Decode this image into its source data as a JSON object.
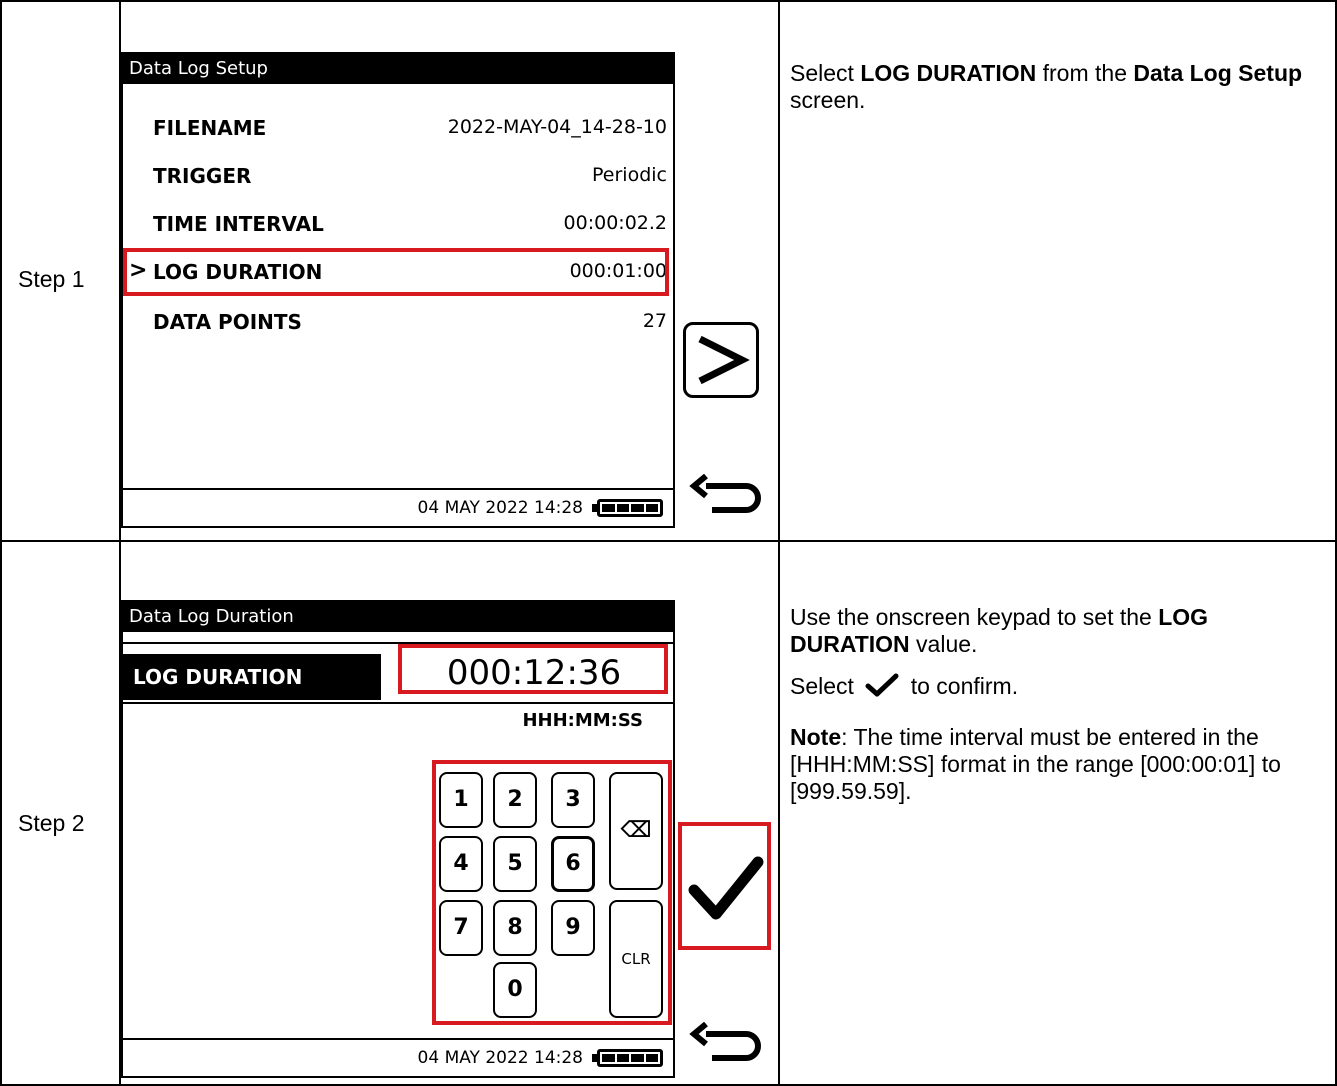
{
  "steps": [
    {
      "label": "Step 1",
      "screen": {
        "title": "Data Log Setup",
        "rows": [
          {
            "label": "FILENAME",
            "value": "2022-MAY-04_14-28-10"
          },
          {
            "label": "TRIGGER",
            "value": "Periodic"
          },
          {
            "label": "TIME INTERVAL",
            "value": "00:00:02.2"
          },
          {
            "label": "LOG DURATION",
            "value": "000:01:00",
            "selected": true
          },
          {
            "label": "DATA POINTS",
            "value": "27"
          }
        ],
        "selector_glyph": ">",
        "status": "04 MAY 2022 14:28"
      },
      "description": {
        "p1_a": "Select ",
        "p1_b": "LOG DURATION",
        "p1_c": " from the ",
        "p1_d": "Data Log Setup",
        "p1_e": " screen."
      }
    },
    {
      "label": "Step 2",
      "screen": {
        "title": "Data Log Duration",
        "field_label": "LOG DURATION",
        "field_value": "000:12:36",
        "format": "HHH:MM:SS",
        "keys": [
          "1",
          "2",
          "3",
          "4",
          "5",
          "6",
          "7",
          "8",
          "9",
          "0"
        ],
        "clear_key": "CLR",
        "backspace_glyph": "⌫",
        "status": "04 MAY 2022 14:28"
      },
      "description": {
        "p1_a": "Use the onscreen keypad to set the ",
        "p1_b": "LOG DURATION",
        "p1_c": " value.",
        "p2_a": "Select ",
        "p2_b": " to confirm.",
        "p3_a": "Note",
        "p3_b": ": The time interval must be entered in the [HHH:MM:SS] format in the range [000:00:01] to [999.59.59]."
      }
    }
  ],
  "colors": {
    "highlight": "#d71920",
    "ink": "#000000"
  },
  "icons": [
    "chevron-right-icon",
    "back-arrow-icon",
    "checkmark-icon",
    "backspace-icon",
    "battery-icon"
  ]
}
